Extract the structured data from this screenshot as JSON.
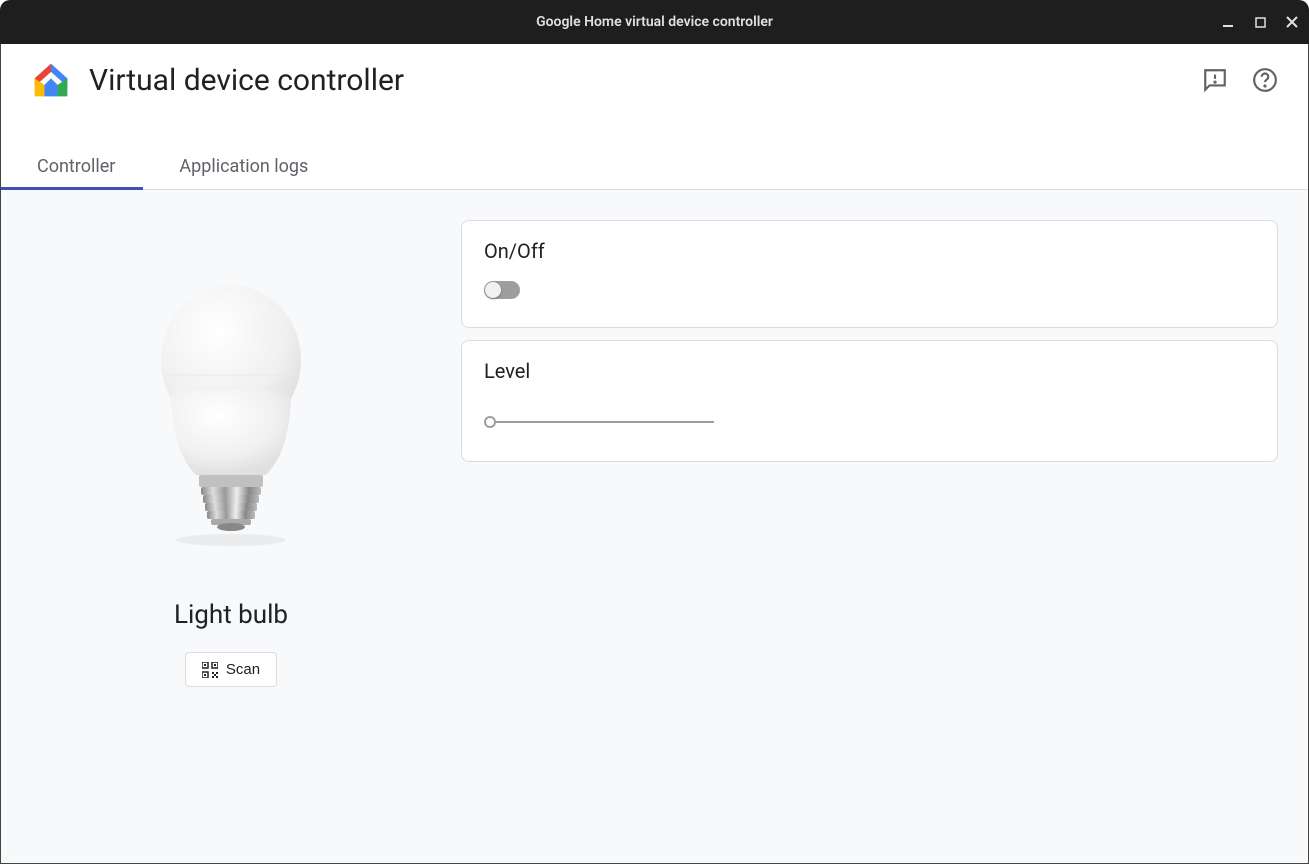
{
  "window": {
    "title": "Google Home virtual device controller"
  },
  "header": {
    "app_title": "Virtual device controller"
  },
  "tabs": [
    {
      "label": "Controller",
      "active": true
    },
    {
      "label": "Application logs",
      "active": false
    }
  ],
  "device": {
    "name": "Light bulb",
    "scan_label": "Scan"
  },
  "controls": {
    "on_off": {
      "label": "On/Off",
      "value": false
    },
    "level": {
      "label": "Level",
      "value": 0
    }
  }
}
